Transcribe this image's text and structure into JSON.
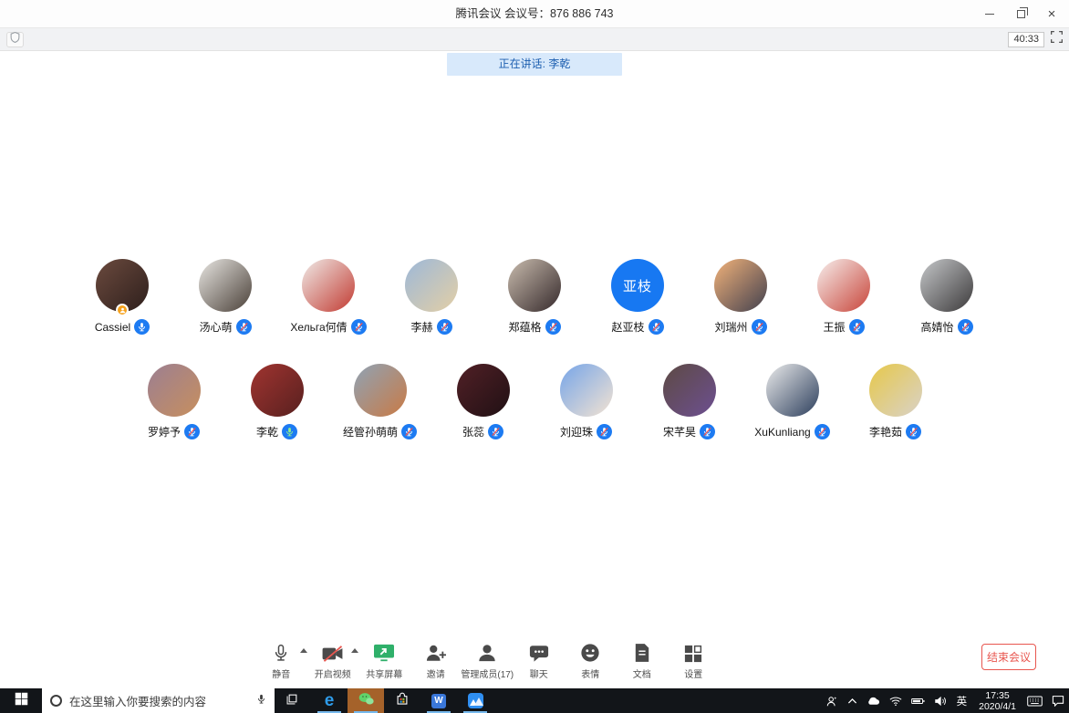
{
  "window": {
    "title": "腾讯会议 会议号：876 886 743"
  },
  "statusbar": {
    "duration": "40:33"
  },
  "banner": {
    "text": "正在讲话: 李乾"
  },
  "participants": {
    "total": 17,
    "rows": [
      [
        {
          "name": "Cassiel",
          "mic": "unmuted",
          "host": true,
          "avatar": {
            "colors": [
              "#6b4a3e",
              "#2e1f1c"
            ]
          }
        },
        {
          "name": "汤心萌",
          "mic": "muted",
          "avatar": {
            "colors": [
              "#e8e6e2",
              "#4a4038"
            ]
          }
        },
        {
          "name": "Хельга何倩",
          "mic": "muted",
          "avatar": {
            "colors": [
              "#f0ebe8",
              "#c23b32"
            ]
          }
        },
        {
          "name": "李赫",
          "mic": "muted",
          "avatar": {
            "colors": [
              "#9db8d8",
              "#e3cfa6"
            ]
          }
        },
        {
          "name": "郑蕴格",
          "mic": "muted",
          "avatar": {
            "colors": [
              "#c9bcae",
              "#35292b"
            ]
          }
        },
        {
          "name": "赵亚枝",
          "mic": "muted",
          "avatar": {
            "colors": [
              "#1778f2"
            ],
            "text": "亚枝"
          }
        },
        {
          "name": "刘瑞州",
          "mic": "muted",
          "avatar": {
            "colors": [
              "#f2b27a",
              "#42404e"
            ]
          }
        },
        {
          "name": "王振",
          "mic": "muted",
          "avatar": {
            "colors": [
              "#f7efed",
              "#c8453a"
            ]
          }
        },
        {
          "name": "高婧怡",
          "mic": "muted",
          "avatar": {
            "colors": [
              "#c5c7c9",
              "#3c3a3b"
            ]
          }
        }
      ],
      [
        {
          "name": "罗婷予",
          "mic": "muted",
          "avatar": {
            "colors": [
              "#9c7f92",
              "#c78f5e"
            ]
          }
        },
        {
          "name": "李乾",
          "mic": "speaking",
          "avatar": {
            "colors": [
              "#a03430",
              "#58201f"
            ]
          }
        },
        {
          "name": "经管孙萌萌",
          "mic": "muted",
          "avatar": {
            "colors": [
              "#8fa3b5",
              "#c97a45"
            ]
          }
        },
        {
          "name": "张蕊",
          "mic": "muted",
          "avatar": {
            "colors": [
              "#512026",
              "#201014"
            ]
          }
        },
        {
          "name": "刘迎珠",
          "mic": "muted",
          "avatar": {
            "colors": [
              "#76a5e8",
              "#f3e3d2"
            ]
          }
        },
        {
          "name": "宋芊昊",
          "mic": "muted",
          "avatar": {
            "colors": [
              "#5d4a43",
              "#6d4f91"
            ]
          }
        },
        {
          "name": "XuKunliang",
          "mic": "muted",
          "avatar": {
            "colors": [
              "#ececec",
              "#2c3e5c"
            ]
          }
        },
        {
          "name": "李艳茹",
          "mic": "muted",
          "avatar": {
            "colors": [
              "#e6c84a",
              "#d9d2c8"
            ]
          }
        }
      ]
    ]
  },
  "toolbar": {
    "items": [
      {
        "label": "静音",
        "icon": "mic",
        "caret": true
      },
      {
        "label": "开启视频",
        "icon": "camera-off",
        "caret": true
      },
      {
        "label": "共享屏幕",
        "icon": "share-screen"
      },
      {
        "label": "邀请",
        "icon": "invite"
      },
      {
        "label": "管理成员(17)",
        "icon": "members"
      },
      {
        "label": "聊天",
        "icon": "chat"
      },
      {
        "label": "表情",
        "icon": "emoji"
      },
      {
        "label": "文档",
        "icon": "docs"
      },
      {
        "label": "设置",
        "icon": "settings"
      }
    ],
    "end_button": "结束会议"
  },
  "taskbar": {
    "search_text": "在这里输入你要搜索的内容",
    "ime": "英",
    "time": "17:35",
    "date": "2020/4/1"
  },
  "colors": {
    "accent_blue": "#1d7bf2",
    "banner_bg": "#d8e9fb",
    "banner_text": "#1d5fb0",
    "end_red": "#e8564f",
    "mute_slash": "#ff5148",
    "speaking_mic": "#8ef08e",
    "wechat_highlight": "#a5622a"
  }
}
